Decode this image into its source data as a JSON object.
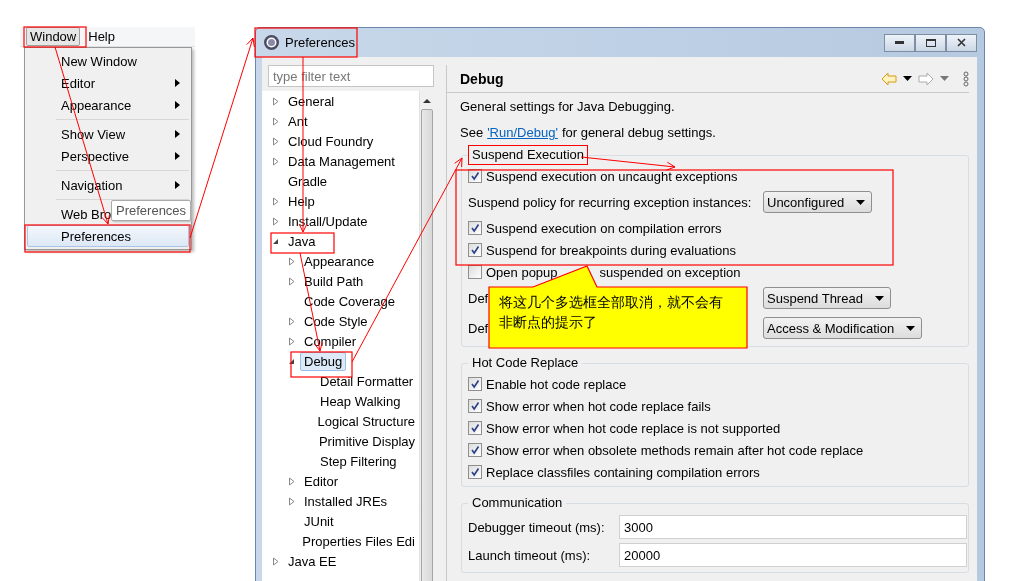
{
  "menu": {
    "menubar": [
      {
        "label": "Window",
        "selected": true
      },
      {
        "label": "Help",
        "selected": false
      }
    ],
    "items": [
      {
        "kind": "item",
        "label": "New Window",
        "submenu": false,
        "selected": false
      },
      {
        "kind": "item",
        "label": "Editor",
        "submenu": true,
        "selected": false
      },
      {
        "kind": "item",
        "label": "Appearance",
        "submenu": true,
        "selected": false
      },
      {
        "kind": "separator"
      },
      {
        "kind": "item",
        "label": "Show View",
        "submenu": true,
        "selected": false
      },
      {
        "kind": "item",
        "label": "Perspective",
        "submenu": true,
        "selected": false
      },
      {
        "kind": "separator"
      },
      {
        "kind": "item",
        "label": "Navigation",
        "submenu": true,
        "selected": false
      },
      {
        "kind": "separator"
      },
      {
        "kind": "item",
        "label": "Web Bro",
        "submenu": false,
        "selected": false,
        "tooltip": "Preferences"
      },
      {
        "kind": "item",
        "label": "Preferences",
        "submenu": false,
        "selected": true
      }
    ]
  },
  "window": {
    "title": "Preferences"
  },
  "filter": {
    "placeholder": "type filter text"
  },
  "tree": [
    {
      "label": "General",
      "kind": "branch",
      "expanded": false,
      "selected": false
    },
    {
      "label": "Ant",
      "kind": "branch",
      "expanded": false,
      "selected": false
    },
    {
      "label": "Cloud Foundry",
      "kind": "branch",
      "expanded": false,
      "selected": false
    },
    {
      "label": "Data Management",
      "kind": "branch",
      "expanded": false,
      "selected": false
    },
    {
      "label": "Gradle",
      "kind": "leaf",
      "selected": false
    },
    {
      "label": "Help",
      "kind": "branch",
      "expanded": false,
      "selected": false
    },
    {
      "label": "Install/Update",
      "kind": "branch",
      "expanded": false,
      "selected": false
    },
    {
      "label": "Java",
      "kind": "branch",
      "expanded": true,
      "selected": false,
      "children": [
        {
          "label": "Appearance",
          "kind": "branch",
          "expanded": false,
          "selected": false
        },
        {
          "label": "Build Path",
          "kind": "branch",
          "expanded": false,
          "selected": false
        },
        {
          "label": "Code Coverage",
          "kind": "leaf",
          "selected": false
        },
        {
          "label": "Code Style",
          "kind": "branch",
          "expanded": false,
          "selected": false
        },
        {
          "label": "Compiler",
          "kind": "branch",
          "expanded": false,
          "selected": false
        },
        {
          "label": "Debug",
          "kind": "branch",
          "expanded": true,
          "selected": true,
          "children": [
            {
              "label": "Detail Formatter",
              "kind": "leaf",
              "selected": false
            },
            {
              "label": "Heap Walking",
              "kind": "leaf",
              "selected": false
            },
            {
              "label": "Logical Structure",
              "kind": "leaf",
              "selected": false
            },
            {
              "label": "Primitive Display",
              "kind": "leaf",
              "selected": false
            },
            {
              "label": "Step Filtering",
              "kind": "leaf",
              "selected": false
            }
          ]
        },
        {
          "label": "Editor",
          "kind": "branch",
          "expanded": false,
          "selected": false
        },
        {
          "label": "Installed JREs",
          "kind": "branch",
          "expanded": false,
          "selected": false
        },
        {
          "label": "JUnit",
          "kind": "leaf",
          "selected": false
        },
        {
          "label": "Properties Files Edi",
          "kind": "leaf",
          "selected": false
        }
      ]
    },
    {
      "label": "Java EE",
      "kind": "branch",
      "expanded": false,
      "selected": false
    }
  ],
  "page": {
    "title": "Debug",
    "description": "General settings for Java Debugging.",
    "see": {
      "before": "See",
      "link": "'Run/Debug'",
      "after": "for general debug settings."
    },
    "groups": [
      {
        "title": "Suspend Execution",
        "rows": [
          {
            "kind": "checkbox",
            "label": "Suspend execution on uncaught exceptions",
            "checked": true
          },
          {
            "kind": "select",
            "label": "Suspend policy for recurring exception instances:",
            "value": "Unconfigured"
          },
          {
            "kind": "checkbox",
            "label": "Suspend execution on compilation errors",
            "checked": true
          },
          {
            "kind": "checkbox",
            "label": "Suspend for breakpoints during evaluations",
            "checked": true
          },
          {
            "kind": "checkbox",
            "label": "Open popup",
            "label_after": "suspended on exception",
            "checked": false
          },
          {
            "kind": "select",
            "label": "Def",
            "value": "Suspend Thread"
          },
          {
            "kind": "select",
            "label": "Def",
            "value": "Access & Modification"
          }
        ]
      },
      {
        "title": "Hot Code Replace",
        "rows": [
          {
            "kind": "checkbox",
            "label": "Enable hot code replace",
            "checked": true
          },
          {
            "kind": "checkbox",
            "label": "Show error when hot code replace fails",
            "checked": true
          },
          {
            "kind": "checkbox",
            "label": "Show error when hot code replace is not supported",
            "checked": true
          },
          {
            "kind": "checkbox",
            "label": "Show error when obsolete methods remain after hot code replace",
            "checked": true
          },
          {
            "kind": "checkbox",
            "label": "Replace classfiles containing compilation errors",
            "checked": true
          }
        ]
      },
      {
        "title": "Communication",
        "rows": [
          {
            "kind": "input",
            "label": "Debugger timeout (ms):",
            "value": "3000"
          },
          {
            "kind": "input",
            "label": "Launch timeout (ms):",
            "value": "20000"
          }
        ]
      }
    ]
  },
  "callout": {
    "text": "将这几个多选框全部取消，就不会有非断点的提示了"
  }
}
